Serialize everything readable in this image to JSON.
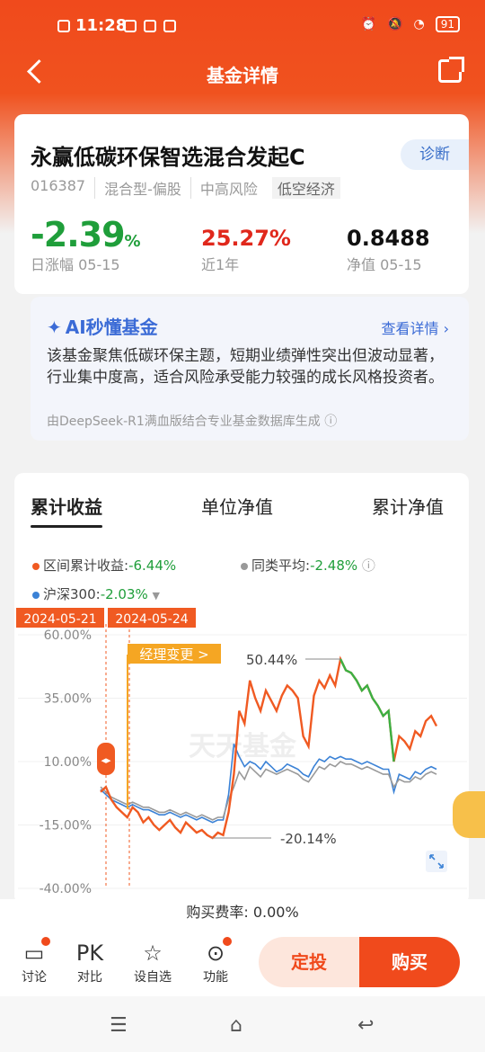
{
  "status": {
    "time": "11:28",
    "battery": "91"
  },
  "nav": {
    "title": "基金详情"
  },
  "fund": {
    "name": "永赢低碳环保智选混合发起C",
    "diagnose": "诊断",
    "code": "016387",
    "type": "混合型-偏股",
    "risk": "中高风险",
    "theme": "低空经济",
    "daily_change": "-2.39",
    "daily_change_unit": "%",
    "daily_label": "日涨幅  05-15",
    "year_return": "25.27%",
    "year_label": "近1年",
    "nav_value": "0.8488",
    "nav_label": "净值  05-15"
  },
  "ai": {
    "title": "AI秒懂基金",
    "more": "查看详情 ›",
    "text": "该基金聚焦低碳环保主题，短期业绩弹性突出但波动显著，行业集中度高，适合风险承受能力较强的成长风格投资者。",
    "source": "由DeepSeek-R1满血版结合专业基金数据库生成 ⓘ"
  },
  "chart_tabs": [
    "累计收益",
    "单位净值",
    "累计净值"
  ],
  "legend": {
    "fund": "区间累计收益:",
    "fund_val": "-6.44%",
    "avg": "同类平均:",
    "avg_val": "-2.48%",
    "hs300": "沪深300:",
    "hs300_val": "-2.03%"
  },
  "chart_data": {
    "type": "line",
    "ylim": [
      -40,
      60
    ],
    "yticks": [
      "60.00%",
      "35.00%",
      "10.00%",
      "-15.00%",
      "-40.00%"
    ],
    "date_markers": [
      "2024-05-21",
      "2024-05-24"
    ],
    "annotations": {
      "event": "经理变更 >",
      "max": "50.44%",
      "min": "-20.14%"
    },
    "watermark": "天天基金",
    "series": [
      {
        "name": "区间累计收益",
        "color": "#f05a22",
        "values": [
          -2,
          0,
          -5,
          -8,
          -10,
          -12,
          -8,
          -10,
          -14,
          -12,
          -15,
          -17,
          -15,
          -13,
          -16,
          -18,
          -14,
          -16,
          -18,
          -17,
          -19,
          -20.14,
          -18,
          -19,
          -10,
          5,
          30,
          25,
          42,
          35,
          30,
          38,
          34,
          30,
          36,
          40,
          38,
          35,
          20,
          16,
          36,
          42,
          39,
          44,
          40,
          50.44,
          46,
          45,
          42,
          38,
          40,
          35,
          32,
          28,
          30,
          10,
          20,
          18,
          15,
          22,
          20,
          26,
          28,
          24
        ]
      },
      {
        "name": "同类平均",
        "color": "#999999",
        "values": [
          0,
          -2,
          -4,
          -5,
          -6,
          -7,
          -6,
          -7,
          -8,
          -8,
          -9,
          -10,
          -10,
          -9,
          -10,
          -11,
          -10,
          -11,
          -12,
          -11,
          -12,
          -13,
          -12,
          -12,
          -5,
          0,
          6,
          3,
          8,
          6,
          4,
          7,
          6,
          5,
          6,
          7,
          6,
          5,
          3,
          2,
          5,
          8,
          7,
          9,
          8,
          10,
          9,
          9,
          8,
          7,
          8,
          7,
          6,
          5,
          5,
          0,
          3,
          2,
          2,
          4,
          3,
          5,
          6,
          5
        ]
      },
      {
        "name": "沪深300",
        "color": "#3b82d6",
        "values": [
          -1,
          -3,
          -5,
          -6,
          -7,
          -8,
          -7,
          -8,
          -9,
          -9,
          -10,
          -11,
          -11,
          -10,
          -11,
          -12,
          -11,
          -12,
          -13,
          -12,
          -13,
          -14,
          -13,
          -13,
          -3,
          17,
          12,
          8,
          10,
          9,
          7,
          10,
          8,
          6,
          7,
          9,
          8,
          7,
          5,
          4,
          8,
          11,
          10,
          12,
          11,
          12,
          11,
          11,
          10,
          9,
          10,
          9,
          8,
          7,
          7,
          -2,
          5,
          4,
          3,
          6,
          5,
          7,
          8,
          7
        ]
      }
    ]
  },
  "fee": "购买费率: 0.00%",
  "bottom": {
    "discuss": "讨论",
    "pk": "PK",
    "compare": "对比",
    "watch": "设自选",
    "func": "功能",
    "dingtou": "定投",
    "buy": "购买"
  },
  "icons": [
    "back-icon",
    "share-icon",
    "spark-icon",
    "info-icon",
    "expand-icon",
    "chat-icon",
    "star-icon",
    "more-icon"
  ]
}
